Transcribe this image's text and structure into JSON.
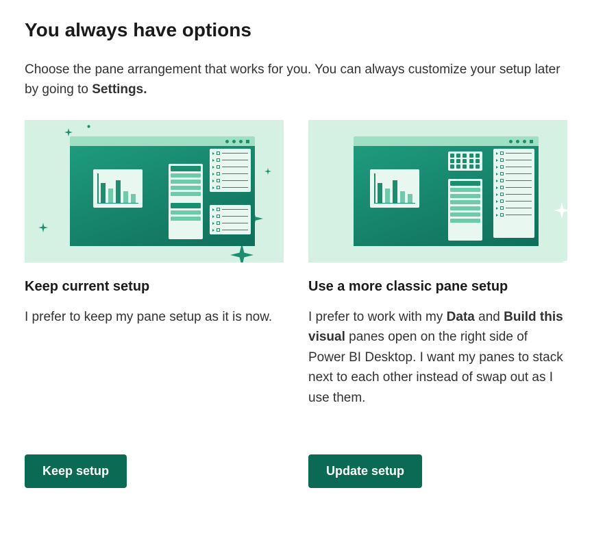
{
  "title": "You always have options",
  "description_pre": "Choose the pane arrangement that works for you. You can always customize your setup later by going to ",
  "description_bold": "Settings.",
  "options": {
    "keep": {
      "title": "Keep current setup",
      "desc": "I prefer to keep my pane setup as it is now.",
      "button": "Keep setup"
    },
    "classic": {
      "title": "Use a more classic pane setup",
      "desc_1": "I prefer to work with my ",
      "desc_b1": "Data",
      "desc_2": " and ",
      "desc_b2": "Build this visual",
      "desc_3": " panes open on the right side of Power BI Desktop. I want my panes to stack next to each other instead of swap out as I use them.",
      "button": "Update setup"
    }
  },
  "colors": {
    "accent": "#0b6a53",
    "illustration_bg": "#d5f1e4"
  }
}
